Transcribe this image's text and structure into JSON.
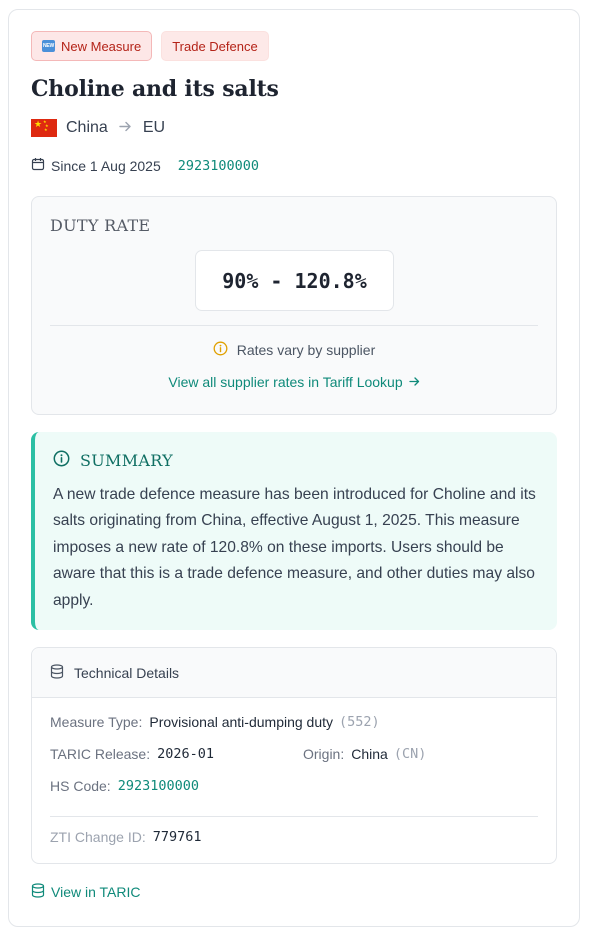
{
  "badges": {
    "new_measure": "New Measure",
    "new_icon_text": "NEW",
    "trade_defence": "Trade Defence"
  },
  "title": "Choline and its salts",
  "route": {
    "origin": "China",
    "destination": "EU",
    "origin_flag": "china-flag-icon"
  },
  "meta": {
    "since": "Since 1 Aug 2025",
    "hs_code": "2923100000"
  },
  "duty": {
    "label": "DUTY RATE",
    "rate": "90% - 120.8%",
    "note": "Rates vary by supplier",
    "link": "View all supplier rates in Tariff Lookup"
  },
  "summary": {
    "heading": "SUMMARY",
    "text": "A new trade defence measure has been introduced for Choline and its salts originating from China, effective August 1, 2025. This measure imposes a new rate of 120.8% on these imports. Users should be aware that this is a trade defence measure, and other duties may also apply."
  },
  "technical": {
    "heading": "Technical Details",
    "measure_type_label": "Measure Type:",
    "measure_type_value": "Provisional anti-dumping duty",
    "measure_type_code": "(552)",
    "taric_release_label": "TARIC Release:",
    "taric_release_value": "2026-01",
    "origin_label": "Origin:",
    "origin_value": "China",
    "origin_code": "(CN)",
    "hs_code_label": "HS Code:",
    "hs_code_value": "2923100000",
    "zti_label": "ZTI Change ID:",
    "zti_value": "779761"
  },
  "footer": {
    "view_taric": "View in TARIC"
  },
  "colors": {
    "accent": "#0f8a7a",
    "badge_red": "#b42318",
    "summary_bg": "#eefbf8",
    "summary_border": "#2bbfa4",
    "info_amber": "#e0a000"
  }
}
